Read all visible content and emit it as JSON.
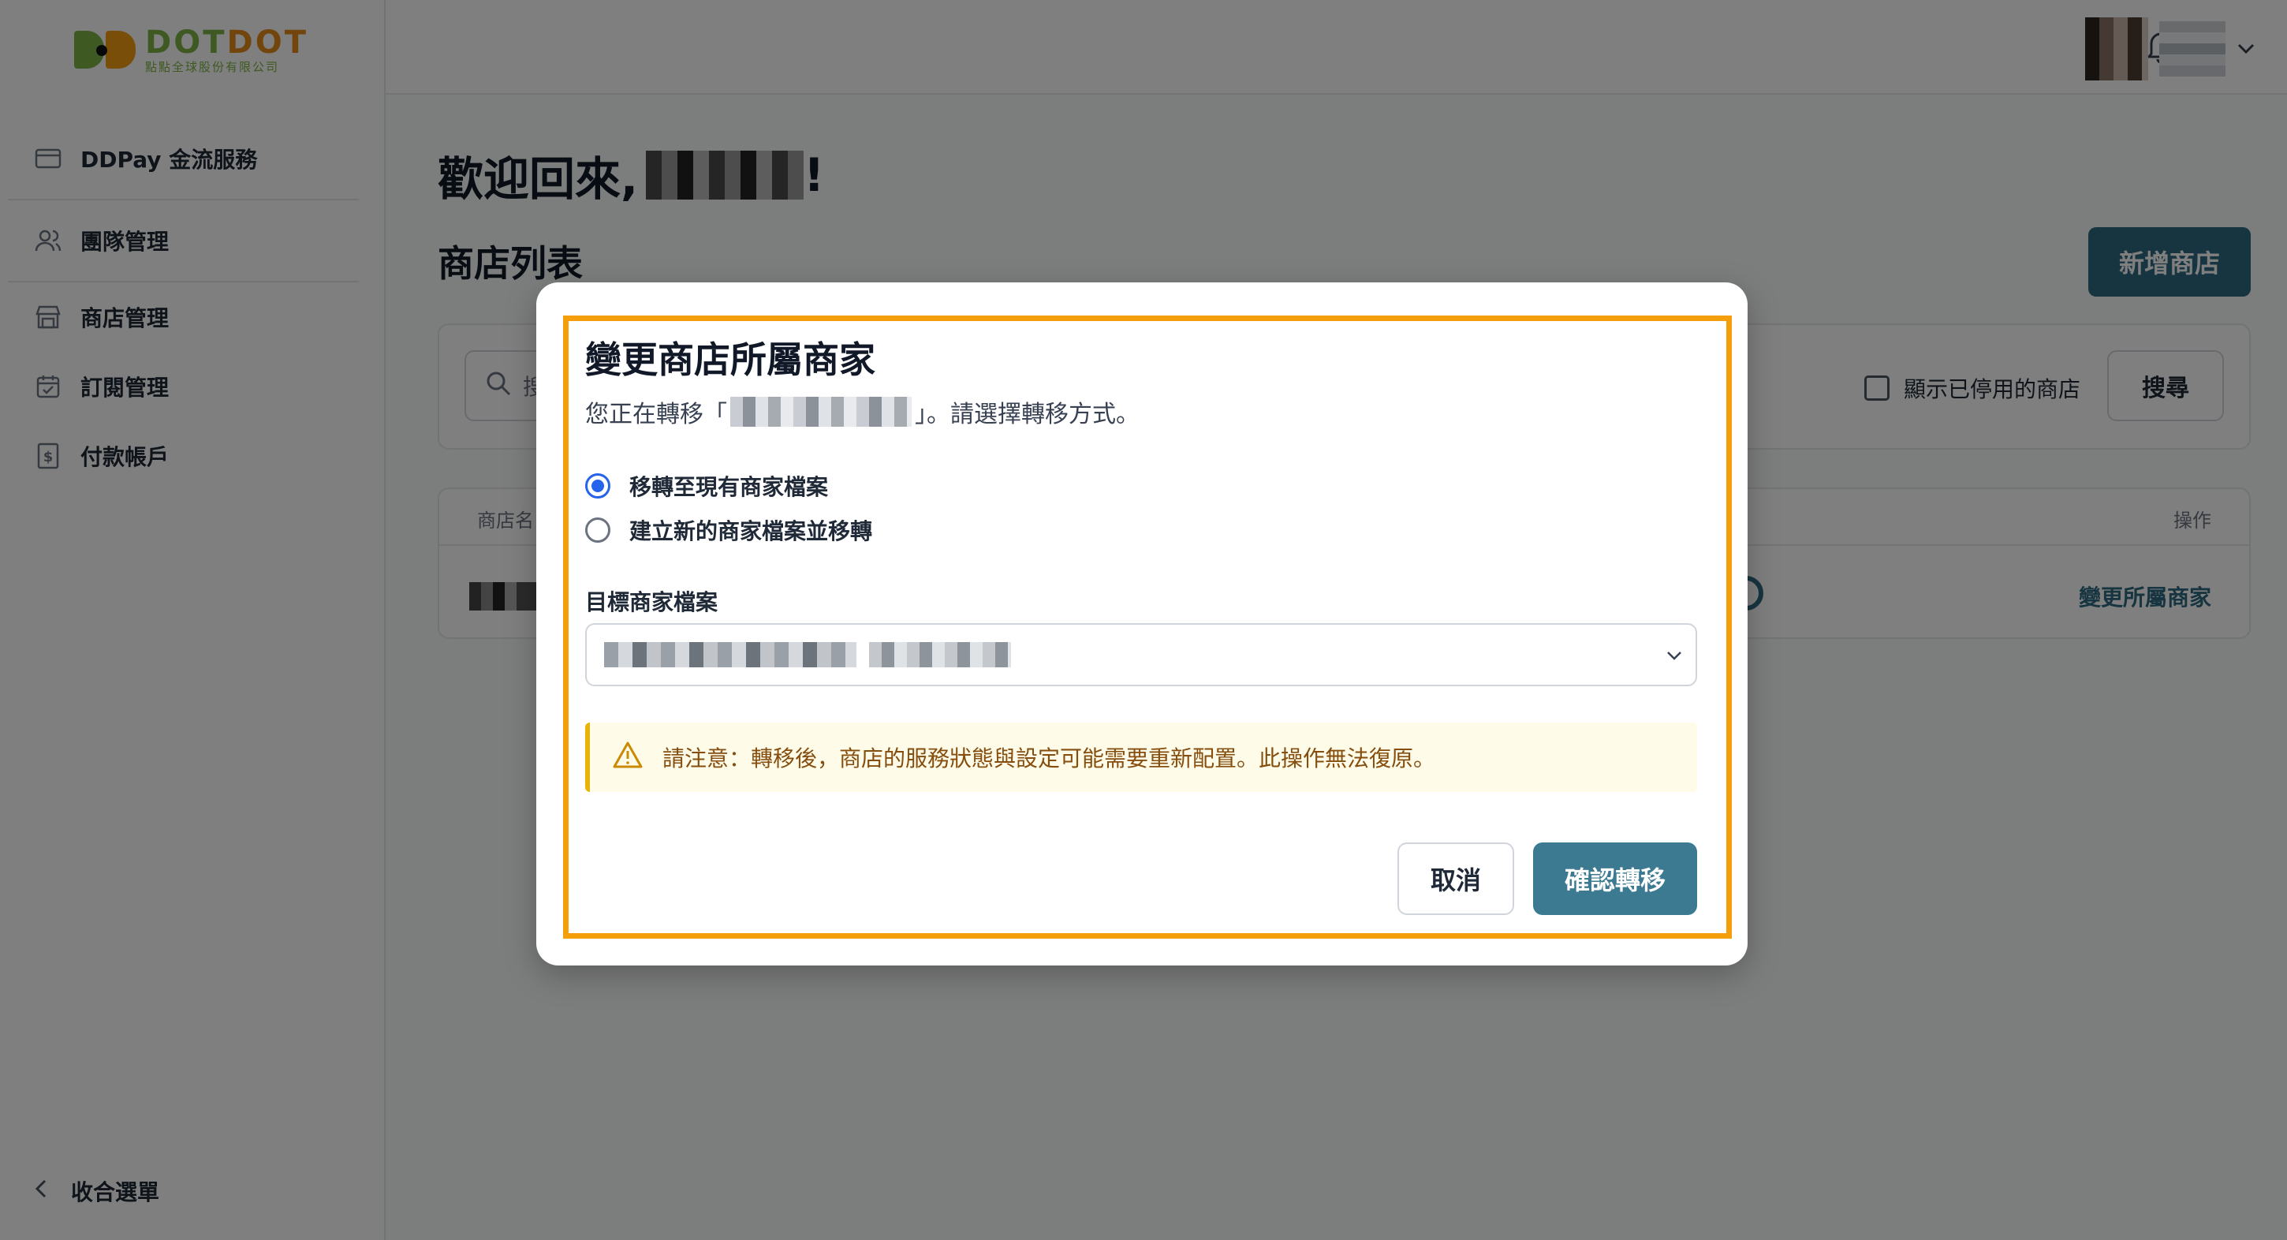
{
  "logo": {
    "wordmark_a": "DOT",
    "wordmark_b": "DOT",
    "subtitle": "點點全球股份有限公司",
    "colors": {
      "green": "#7cb342",
      "orange": "#e58b1a"
    }
  },
  "sidebar": {
    "items": [
      {
        "label": "DDPay 金流服務",
        "icon": "credit-card-icon"
      },
      {
        "label": "團隊管理",
        "icon": "users-icon"
      },
      {
        "label": "商店管理",
        "icon": "store-icon"
      },
      {
        "label": "訂閱管理",
        "icon": "calendar-icon"
      },
      {
        "label": "付款帳戶",
        "icon": "dollar-document-icon"
      }
    ],
    "collapse_label": "收合選單"
  },
  "header": {
    "notification_icon": "bell-icon",
    "user_menu_icon": "chevron-down-icon"
  },
  "main": {
    "welcome": "歡迎回來,",
    "welcome_suffix": "!",
    "store_list_title": "商店列表",
    "add_store_button": "新增商店",
    "search_placeholder": "搜",
    "show_disabled_label": "顯示已停用的商店",
    "search_button": "搜尋",
    "table": {
      "columns": [
        "商店名",
        "操作"
      ],
      "row_action": "變更所屬商家"
    }
  },
  "modal": {
    "title": "變更商店所屬商家",
    "desc_prefix": "您正在轉移「",
    "desc_suffix": "」。請選擇轉移方式。",
    "options": [
      {
        "label": "移轉至現有商家檔案",
        "selected": true
      },
      {
        "label": "建立新的商家檔案並移轉",
        "selected": false
      }
    ],
    "target_label": "目標商家檔案",
    "warning": "請注意：轉移後，商店的服務狀態與設定可能需要重新配置。此操作無法復原。",
    "cancel_button": "取消",
    "confirm_button": "確認轉移"
  },
  "colors": {
    "primary": "#2f6b80",
    "highlight": "#f59e0b",
    "radio": "#2563eb",
    "alert_bg": "#fefce8",
    "alert_border": "#eab308"
  }
}
